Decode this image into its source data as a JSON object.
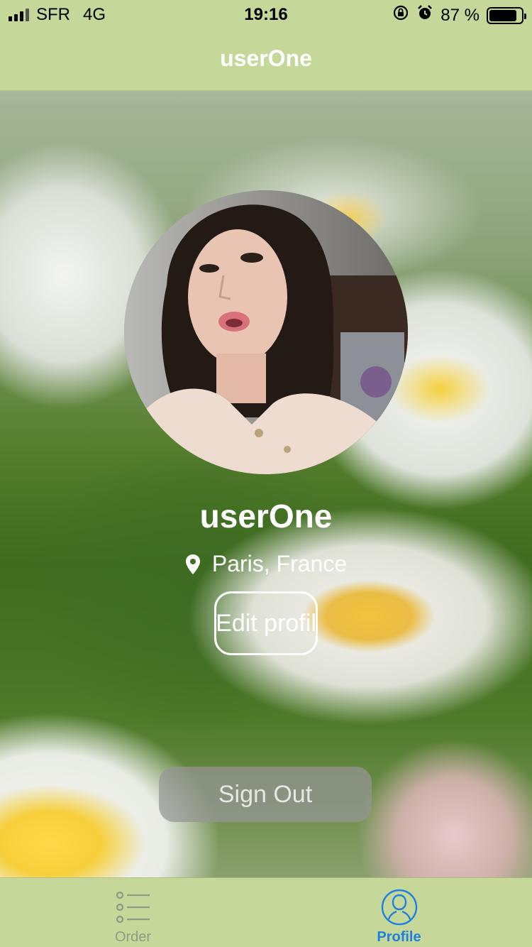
{
  "status_bar": {
    "carrier": "SFR",
    "network": "4G",
    "time": "19:16",
    "battery_text": "87 %",
    "battery_level": 0.87
  },
  "nav": {
    "title": "userOne"
  },
  "profile": {
    "name": "userOne",
    "location": "Paris, France",
    "edit_label": "Edit profil"
  },
  "actions": {
    "sign_out_label": "Sign Out"
  },
  "tab_bar": {
    "tabs": [
      {
        "label": "Order",
        "icon": "list-icon",
        "active": false
      },
      {
        "label": "Profile",
        "icon": "person-icon",
        "active": true
      }
    ]
  },
  "colors": {
    "bar_background": "#c5d89a",
    "active_tab": "#1f7fe0",
    "inactive_tab": "#8e9a84"
  }
}
